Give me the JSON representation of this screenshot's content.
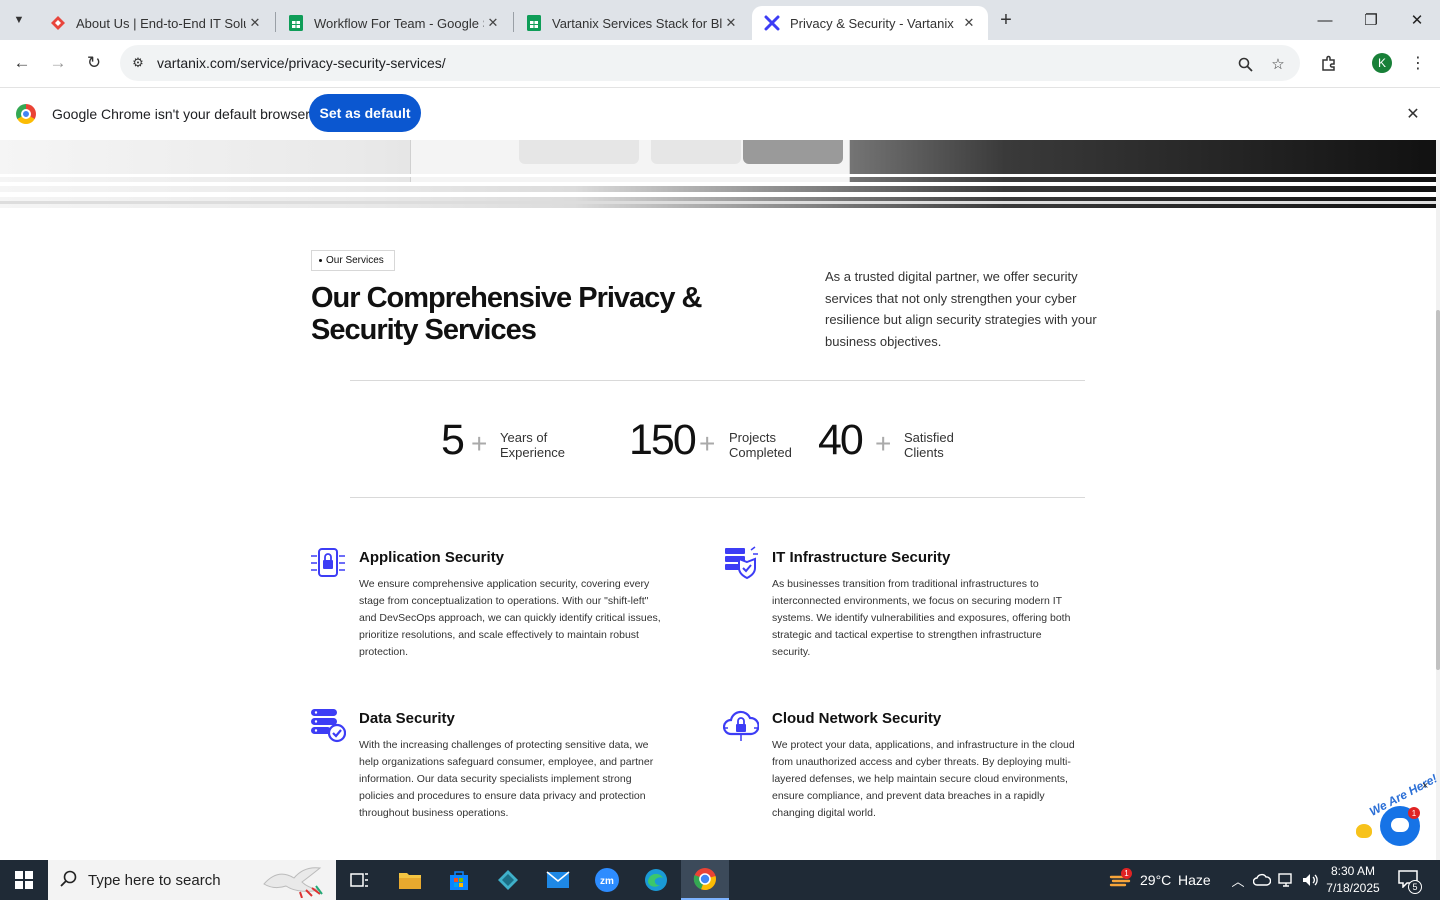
{
  "browser": {
    "tabs": [
      {
        "title": "About Us | End-to-End IT Soluti",
        "favicon": "red-diamond-icon"
      },
      {
        "title": "Workflow For Team - Google Sh",
        "favicon": "sheets-icon"
      },
      {
        "title": "Vartanix Services Stack for Blog",
        "favicon": "sheets-icon"
      },
      {
        "title": "Privacy & Security - Vartanix",
        "favicon": "vartanix-x-icon"
      }
    ],
    "active_tab_index": 3,
    "url": "vartanix.com/service/privacy-security-services/",
    "profile_initial": "K"
  },
  "infobar": {
    "message": "Google Chrome isn't your default browser",
    "button_label": "Set as default"
  },
  "page": {
    "eyebrow": "Our Services",
    "headline_line1": "Our Comprehensive Privacy & ",
    "headline_line2": "Security Services",
    "intro": "As a trusted digital partner, we offer security services that not only strengthen your cyber resilience but align security strategies with your business objectives.",
    "stats": [
      {
        "value": "5",
        "suffix": "+",
        "label_line1": "Years of",
        "label_line2": "Experience"
      },
      {
        "value": "150",
        "suffix": "+",
        "label_line1": "Projects",
        "label_line2": "Completed"
      },
      {
        "value": "40",
        "suffix": "+",
        "label_line1": "Satisfied",
        "label_line2": "Clients"
      }
    ],
    "services": [
      {
        "title": "Application Security",
        "icon": "application-lock-icon",
        "description": "We ensure comprehensive application security, covering every stage from conceptualization to operations. With our \"shift-left\" and DevSecOps approach, we can quickly identify critical issues, prioritize resolutions, and scale effectively to maintain robust protection."
      },
      {
        "title": "IT Infrastructure Security",
        "icon": "server-shield-icon",
        "description": "As businesses transition from traditional infrastructures to interconnected environments, we focus on securing modern IT systems. We identify vulnerabilities and exposures, offering both strategic and tactical expertise to strengthen infrastructure security."
      },
      {
        "title": "Data Security",
        "icon": "database-check-icon",
        "description": "With the increasing challenges of protecting sensitive data, we help organizations safeguard consumer, employee, and partner information. Our data security specialists implement strong policies and procedures to ensure data privacy and protection throughout business operations."
      },
      {
        "title": "Cloud Network Security",
        "icon": "cloud-lock-icon",
        "description": "We protect your data, applications, and infrastructure in the cloud from unauthorized access and cyber threats. By deploying multi-layered defenses, we help maintain secure cloud environments, ensure compliance, and prevent data breaches in a rapidly changing digital world."
      }
    ],
    "chat_widget": {
      "banner": "We Are Here!",
      "badge": "1",
      "close": "×"
    }
  },
  "colors": {
    "accent": "#3d3df5",
    "chrome_blue": "#0b57d0",
    "taskbar": "#1f2a36"
  },
  "taskbar": {
    "search_placeholder": "Type here to search",
    "weather_temp": "29°C",
    "weather_text": "Haze",
    "weather_badge": "1",
    "time": "8:30 AM",
    "date": "7/18/2025",
    "notification_count": "5"
  }
}
